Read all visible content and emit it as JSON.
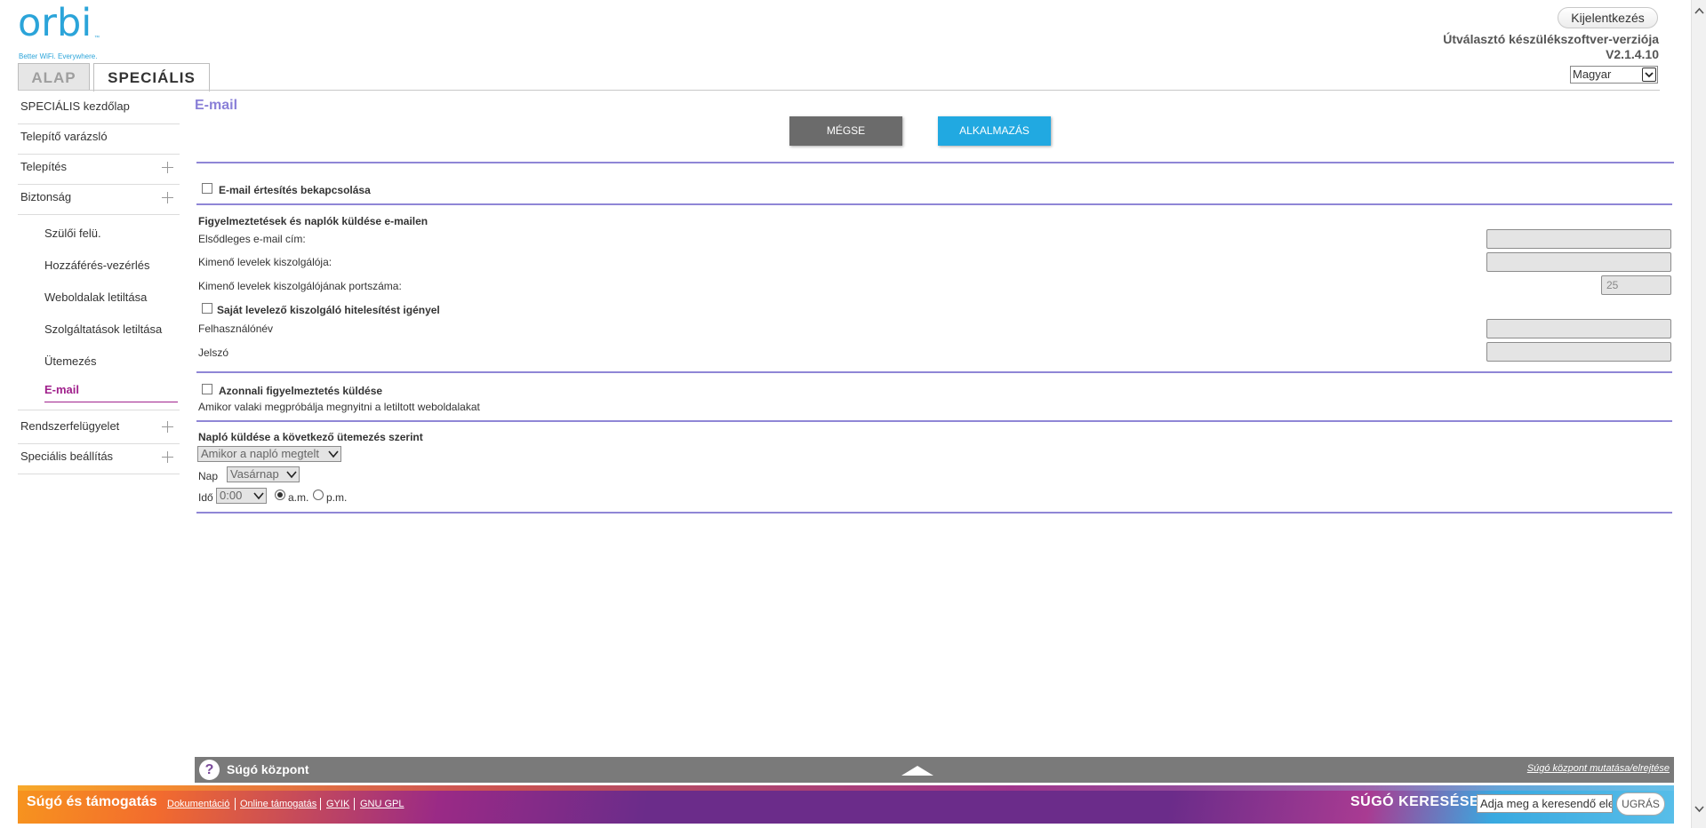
{
  "header": {
    "logo_word": "orbi",
    "logo_tm": "™",
    "logo_tagline": "Better WiFi. Everywhere.",
    "logout_label": "Kijelentkezés",
    "firmware_label": "Útválasztó készülékszoftver-verziója",
    "firmware_version": "V2.1.4.10",
    "language_selected": "Magyar"
  },
  "tabs": [
    {
      "label": "ALAP",
      "active": false
    },
    {
      "label": "SPECIÁLIS",
      "active": true
    }
  ],
  "sidebar": {
    "items": [
      {
        "label": "SPECIÁLIS kezdőlap",
        "expandable": false
      },
      {
        "label": "Telepítő varázsló",
        "expandable": false
      },
      {
        "label": "Telepítés",
        "expandable": true
      },
      {
        "label": "Biztonság",
        "expandable": true
      }
    ],
    "security_subitems": [
      {
        "label": "Szülői felü."
      },
      {
        "label": "Hozzáférés-vezérlés"
      },
      {
        "label": "Weboldalak letiltása"
      },
      {
        "label": "Szolgáltatások letiltása"
      },
      {
        "label": "Ütemezés"
      },
      {
        "label": "E-mail",
        "active": true
      }
    ],
    "bottom_items": [
      {
        "label": "Rendszerfelügyelet",
        "expandable": true
      },
      {
        "label": "Speciális beállítás",
        "expandable": true
      }
    ]
  },
  "main": {
    "title": "E-mail",
    "cancel_label": "MÉGSE",
    "apply_label": "ALKALMAZÁS",
    "enable_email_label": "E-mail értesítés bekapcsolása",
    "section_alerts_title": "Figyelmeztetések és naplók küldése e-mailen",
    "primary_email_label": "Elsődleges e-mail cím:",
    "primary_email_value": "",
    "outgoing_server_label": "Kimenő levelek kiszolgálója:",
    "outgoing_server_value": "",
    "outgoing_port_label": "Kimenő levelek kiszolgálójának portszáma:",
    "outgoing_port_value": "25",
    "auth_required_label": "Saját levelező kiszolgáló hitelesítést igényel",
    "username_label": "Felhasználónév",
    "username_value": "",
    "password_label": "Jelszó",
    "password_value": "",
    "instant_alert_label": "Azonnali figyelmeztetés küldése",
    "instant_alert_desc": "Amikor valaki megpróbálja megnyitni a letiltott weboldalakat",
    "schedule_title": "Napló küldése a következő ütemezés szerint",
    "schedule_selected": "Amikor a napló megtelt",
    "day_label": "Nap",
    "day_selected": "Vasárnap",
    "time_label": "Idő",
    "time_selected": "0:00",
    "am_label": "a.m.",
    "pm_label": "p.m.",
    "am_selected": true
  },
  "help_bar": {
    "icon_glyph": "?",
    "title": "Súgó központ",
    "toggle_label": "Súgó központ mutatása/elrejtése"
  },
  "footer": {
    "title": "Súgó és támogatás",
    "links": [
      "Dokumentáció",
      "Online támogatás",
      "GYIK",
      "GNU GPL"
    ],
    "search_label": "SÚGÓ KERESÉSE",
    "search_placeholder": "Adja meg a keresendő elemet",
    "go_label": "UGRÁS"
  },
  "colors": {
    "accent_purple": "#8f86d6",
    "active_nav": "#a0218c",
    "apply_blue": "#21a9e1",
    "cancel_gray": "#6b6b6b"
  }
}
